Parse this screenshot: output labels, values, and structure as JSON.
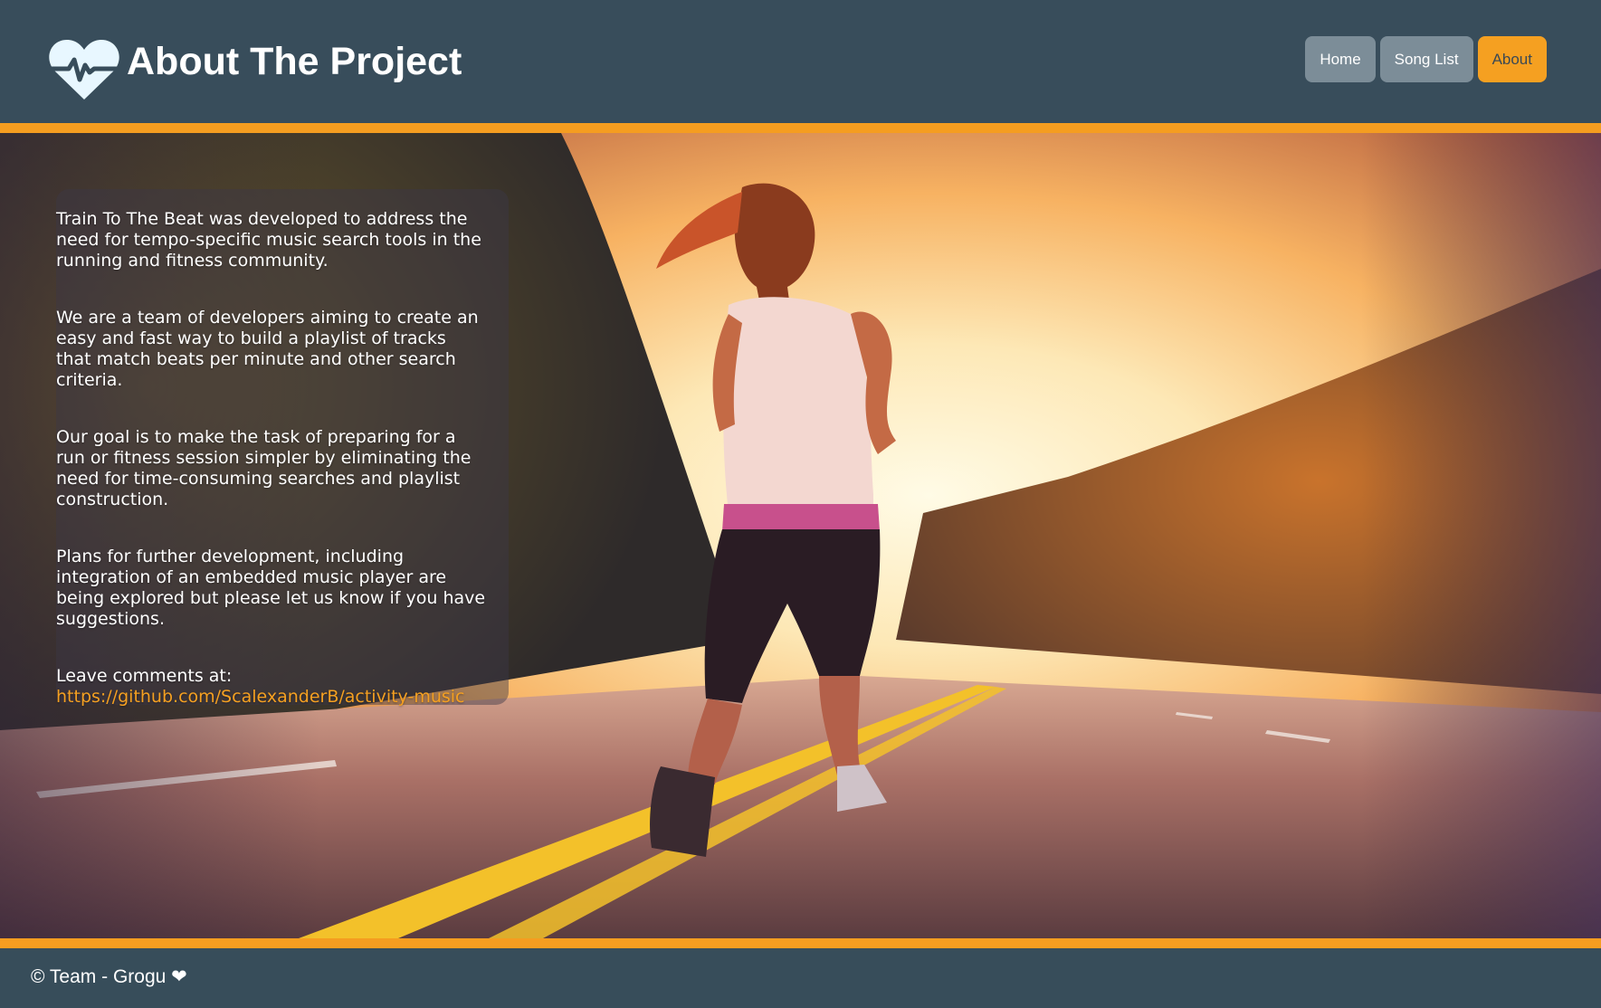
{
  "header": {
    "title": "About The Project",
    "logo_icon": "heartbeat-icon",
    "nav": [
      {
        "label": "Home",
        "active": false
      },
      {
        "label": "Song List",
        "active": false
      },
      {
        "label": "About",
        "active": true
      }
    ]
  },
  "about": {
    "paragraphs": [
      "Train To The Beat was developed to address the need for tempo-specific music search tools in the running and fitness community.",
      "We are a team of developers aiming to create an easy and fast way to build a playlist of tracks that match beats per minute and other search criteria.",
      "Our goal is to make the task of preparing for a run or fitness session simpler by eliminating the need for time-consuming searches and playlist construction.",
      "Plans for further development, including integration of an embedded music player are being explored but please let us know if you have suggestions."
    ],
    "comments_label": "Leave comments at:",
    "comments_link": "https://github.com/ScalexanderB/activity-music"
  },
  "footer": {
    "copyright": "© Team - Grogu ❤"
  },
  "colors": {
    "header_bg": "#384d5b",
    "accent": "#f5a021",
    "nav_button": "#7c8d98"
  }
}
